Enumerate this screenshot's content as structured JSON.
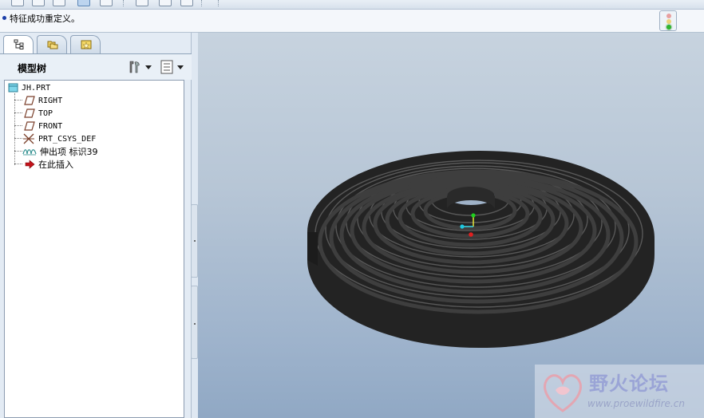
{
  "message": {
    "text": "特征成功重定义。"
  },
  "panel": {
    "title": "模型树"
  },
  "tree": {
    "root": "JH.PRT",
    "items": [
      {
        "label": "RIGHT",
        "icon": "datum-plane-icon"
      },
      {
        "label": "TOP",
        "icon": "datum-plane-icon"
      },
      {
        "label": "FRONT",
        "icon": "datum-plane-icon"
      },
      {
        "label": "PRT_CSYS_DEF",
        "icon": "coordinate-system-icon"
      },
      {
        "label": "伸出项 标识39",
        "icon": "protrusion-icon"
      },
      {
        "label": "在此插入",
        "icon": "insert-here-arrow-icon"
      }
    ]
  },
  "watermark": {
    "title": "野火论坛",
    "url": "www.proewildfire.cn"
  },
  "colors": {
    "accent": "#1b3ea8",
    "tree_border": "#8c9cb0",
    "model": "#262626",
    "viewport_top": "#c7d3df",
    "viewport_bottom": "#90a8c4"
  }
}
